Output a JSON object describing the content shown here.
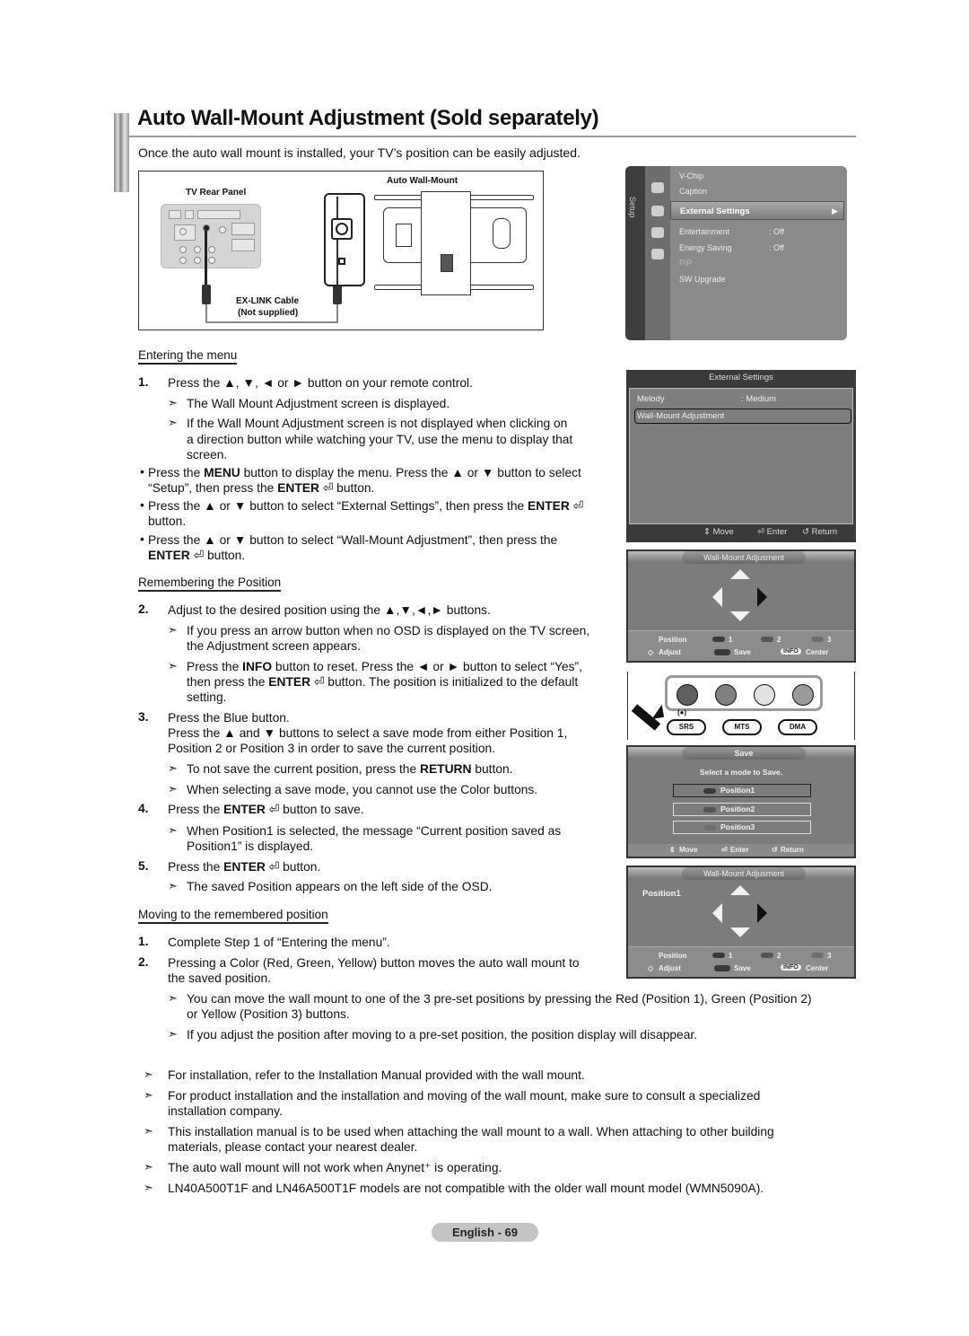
{
  "header": {
    "title": "Auto Wall-Mount Adjustment (Sold separately)",
    "intro": "Once the auto wall mount is installed, your TV’s position can be easily adjusted."
  },
  "diagram": {
    "rear_panel_label": "TV Rear Panel",
    "mount_label": "Auto Wall-Mount",
    "cable_label_1": "EX-LINK Cable",
    "cable_label_2": "(Not supplied)"
  },
  "sections": {
    "entering": {
      "heading": "Entering the menu",
      "step1_num": "1.",
      "step1": "Press the ▲, ▼, ◄ or ► button on your remote control.",
      "note1": "The Wall Mount Adjustment screen is displayed.",
      "note2_l1": "If the Wall Mount Adjustment screen is not displayed when clicking on",
      "note2_l2": "a direction button while watching your TV, use the menu to display that",
      "note2_l3": "screen.",
      "bullet1_a": "Press the ",
      "bullet1_b": "MENU",
      "bullet1_c": " button to display the menu. Press the ▲ or ▼ button to select",
      "bullet1_d": "“Setup”, then press the ",
      "bullet1_e": "ENTER",
      "bullet1_f": " ⏎ button.",
      "bullet2_a": "Press the ▲ or ▼ button to select “External Settings”, then press the ",
      "bullet2_b": "ENTER",
      "bullet2_c": " ⏎",
      "bullet2_d": "button.",
      "bullet3_a": "Press the ▲ or ▼ button to select “Wall-Mount Adjustment”, then press the",
      "bullet3_b": "ENTER",
      "bullet3_c": " ⏎ button."
    },
    "remembering": {
      "heading": "Remembering the Position",
      "step2_num": "2.",
      "step2": "Adjust to the desired position using the ▲,▼,◄,► buttons.",
      "note1_l1": "If you press an arrow button when no OSD is displayed on the TV screen,",
      "note1_l2": "the Adjustment screen appears.",
      "note2_a": "Press the ",
      "note2_b": "INFO",
      "note2_c": " button to reset. Press the ◄ or ► button to select “Yes”,",
      "note2_d": "then press the ",
      "note2_e": "ENTER",
      "note2_f": " ⏎ button. The position is initialized to the default",
      "note2_g": "setting.",
      "step3_num": "3.",
      "step3_l1": "Press the Blue button.",
      "step3_l2": "Press the ▲ and ▼ buttons to select a save mode from either Position 1,",
      "step3_l3": "Position 2 or Position 3 in order to save the current position.",
      "note3_a": "To not save the current position, press the ",
      "note3_b": "RETURN",
      "note3_c": " button.",
      "note4": "When selecting a save mode, you cannot use the Color buttons.",
      "step4_num": "4.",
      "step4_a": "Press the ",
      "step4_b": "ENTER",
      "step4_c": " ⏎ button to save.",
      "note5_l1": "When Position1 is selected, the message “Current position saved as",
      "note5_l2": "Position1” is displayed.",
      "step5_num": "5.",
      "step5_a": "Press the ",
      "step5_b": "ENTER",
      "step5_c": " ⏎ button.",
      "note6": "The saved Position appears on the left side of the OSD."
    },
    "moving": {
      "heading": "Moving to the remembered position",
      "step1_num": "1.",
      "step1": "Complete Step 1 of “Entering the menu”.",
      "step2_num": "2.",
      "step2_l1": "Pressing a Color (Red, Green, Yellow) button moves the auto wall mount to",
      "step2_l2": "the saved position.",
      "note1_l1": "You can move the wall mount to one of the 3 pre-set positions by pressing the Red (Position 1), Green (Position 2)",
      "note1_l2": "or Yellow (Position 3) buttons.",
      "note2": "If you adjust the position after moving to a pre-set position, the position display will disappear."
    }
  },
  "general_notes": [
    {
      "l1": "For installation, refer to the Installation Manual provided with the wall mount.",
      "l2": ""
    },
    {
      "l1": "For product installation and the installation and moving of the wall mount, make sure to consult a specialized",
      "l2": "installation company."
    },
    {
      "l1": "This installation manual is to be used when attaching the wall mount to a wall. When attaching to other building",
      "l2": "materials, please contact your nearest dealer."
    },
    {
      "l1": "The auto wall mount will not work when Anynet⁺ is operating.",
      "l2": ""
    },
    {
      "l1": "LN40A500T1F and LN46A500T1F models are not compatible with the older wall mount model (WMN5090A).",
      "l2": ""
    }
  ],
  "arrow_glyph": "➣",
  "bullet_glyph": "•",
  "setup_osd": {
    "tab_label": "Setup",
    "items": [
      {
        "label": "V-Chip",
        "value": ""
      },
      {
        "label": "Caption",
        "value": ""
      },
      {
        "label": "External Settings",
        "value": "▶"
      },
      {
        "label": "Entertainment",
        "value": ": Off"
      },
      {
        "label": "Energy Saving",
        "value": ": Off"
      },
      {
        "label": "PIP",
        "value": ""
      },
      {
        "label": "SW Upgrade",
        "value": ""
      }
    ],
    "selected": "External Settings"
  },
  "external_osd": {
    "title": "External Settings",
    "rows": [
      {
        "label": "Melody",
        "value": ": Medium"
      },
      {
        "label": "Wall-Mount Adjustment",
        "value": ""
      }
    ],
    "footer": {
      "move": "⇕ Move",
      "enter": "⏎ Enter",
      "return": "↺ Return"
    }
  },
  "wallmount_osd": {
    "title": "Wall-Mount Adjusment",
    "position_label": "Position",
    "pos1": "1",
    "pos2": "2",
    "pos3": "3",
    "adjust": "Adjust",
    "save": "Save",
    "info": "INFO",
    "center": "Center",
    "saved_position": "Position1"
  },
  "remote": {
    "srs": "SRS",
    "mts": "MTS",
    "dma": "DMA",
    "sound_icon": "(●)"
  },
  "save_osd": {
    "title": "Save",
    "message": "Select a mode to Save.",
    "options": [
      "Position1",
      "Position2",
      "Position3"
    ],
    "selected": "Position1",
    "footer": {
      "move": "Move",
      "enter": "Enter",
      "return": "Return"
    }
  },
  "colors": {
    "pos1": "#3a3a3a",
    "pos2": "#555555",
    "pos3": "#6e6e6e",
    "remote_red": "#606060",
    "remote_green": "#808080",
    "remote_yellow": "#e2e2e2",
    "remote_blue": "#9a9a9a"
  },
  "footer": {
    "page": "English - 69"
  }
}
